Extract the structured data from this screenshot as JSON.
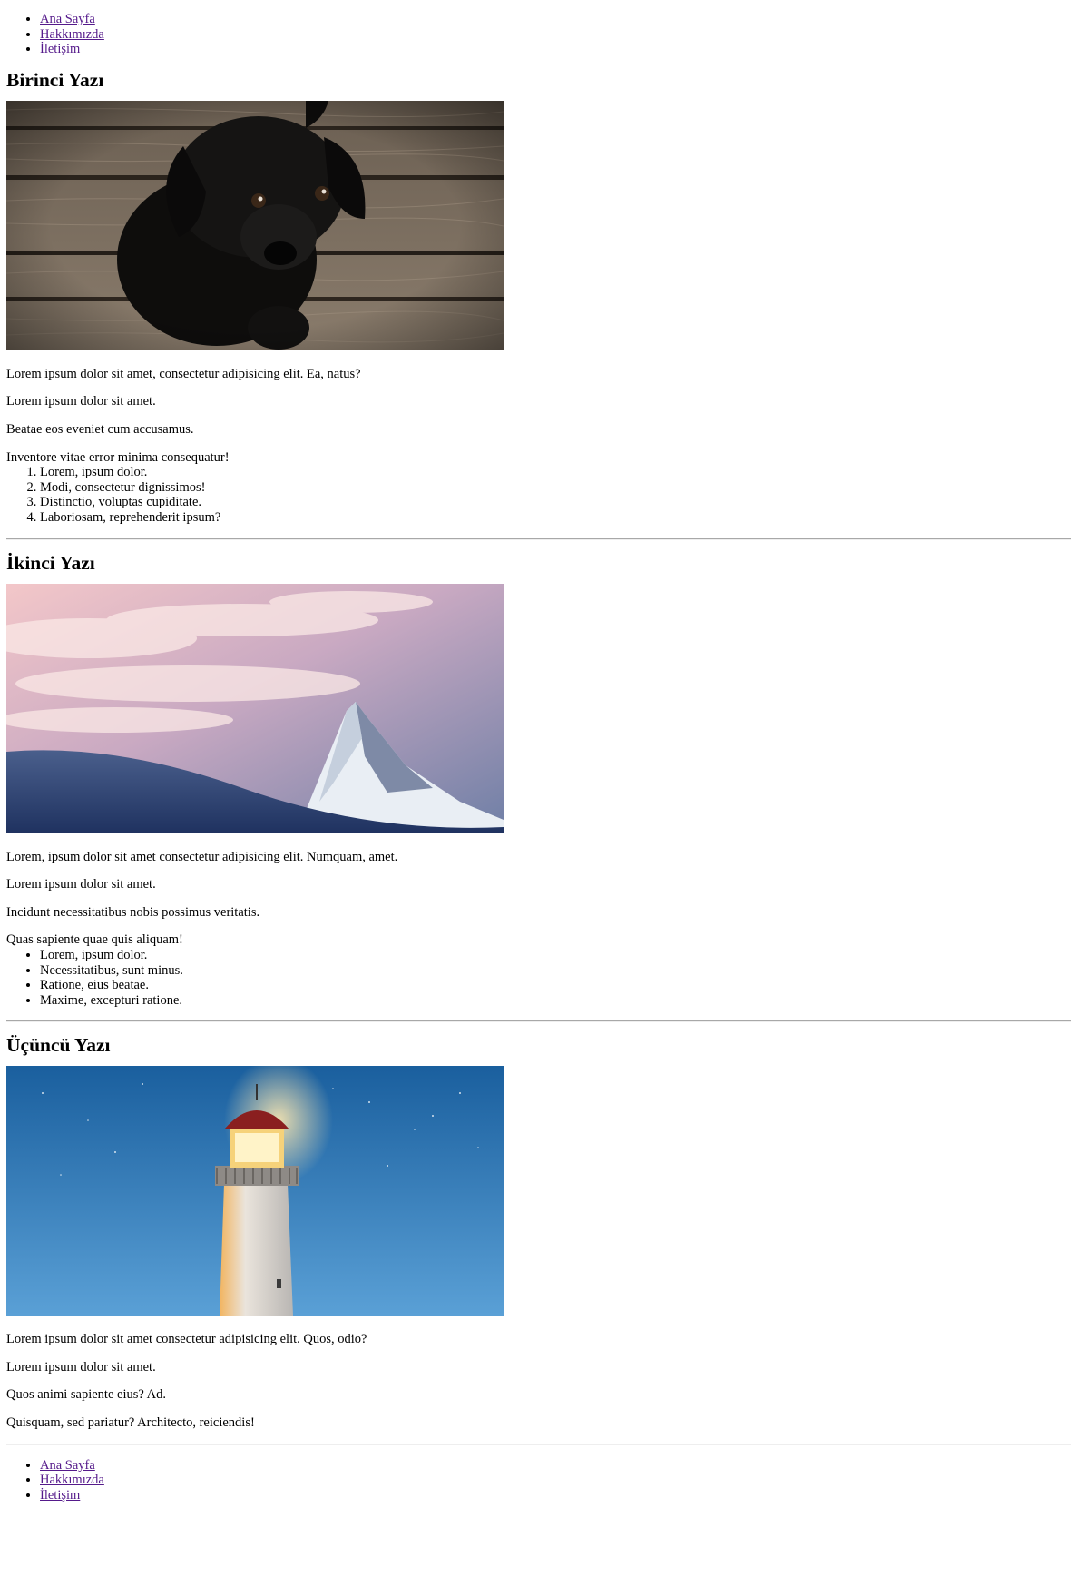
{
  "nav": {
    "items": [
      "Ana Sayfa",
      "Hakkımızda",
      "İletişim"
    ]
  },
  "posts": [
    {
      "title": "Birinci Yazı",
      "image": "black-puppy-on-wood-photo",
      "paragraphs": [
        "Lorem ipsum dolor sit amet, consectetur adipisicing elit. Ea, natus?",
        "Lorem ipsum dolor sit amet.",
        "Beatae eos eveniet cum accusamus.",
        "Inventore vitae error minima consequatur!"
      ],
      "list_type": "ordered",
      "list": [
        "Lorem, ipsum dolor.",
        "Modi, consectetur dignissimos!",
        "Distinctio, voluptas cupiditate.",
        "Laboriosam, reprehenderit ipsum?"
      ]
    },
    {
      "title": "İkinci Yazı",
      "image": "snowy-mountain-peak-photo",
      "paragraphs": [
        "Lorem, ipsum dolor sit amet consectetur adipisicing elit. Numquam, amet.",
        "Lorem ipsum dolor sit amet.",
        "Incidunt necessitatibus nobis possimus veritatis.",
        "Quas sapiente quae quis aliquam!"
      ],
      "list_type": "unordered",
      "list": [
        "Lorem, ipsum dolor.",
        "Necessitatibus, sunt minus.",
        "Ratione, eius beatae.",
        "Maxime, excepturi ratione."
      ]
    },
    {
      "title": "Üçüncü Yazı",
      "image": "lighthouse-night-sky-photo",
      "paragraphs": [
        "Lorem ipsum dolor sit amet consectetur adipisicing elit. Quos, odio?",
        "Lorem ipsum dolor sit amet.",
        "Quos animi sapiente eius? Ad.",
        "Quisquam, sed pariatur? Architecto, reiciendis!"
      ]
    }
  ],
  "footer_nav": {
    "items": [
      "Ana Sayfa",
      "Hakkımızda",
      "İletişim"
    ]
  },
  "colors": {
    "link_visited": "#551a8b",
    "link": "#0000ee",
    "rule": "#a8a8a8"
  }
}
